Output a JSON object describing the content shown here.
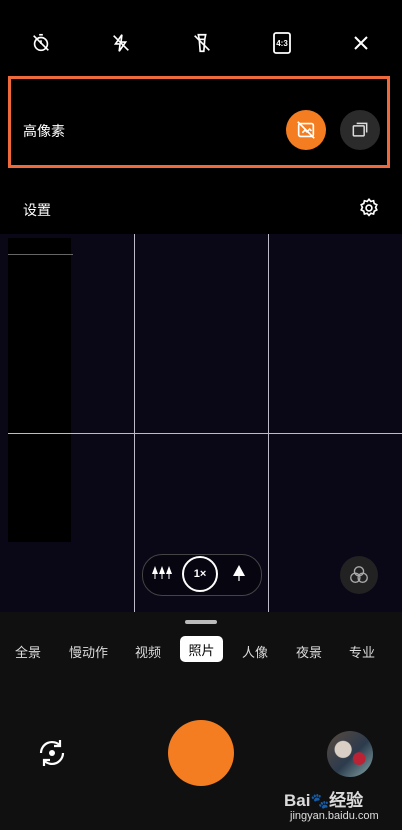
{
  "top_toolbar": {
    "icons": [
      "timer-off-icon",
      "flash-off-icon",
      "torch-off-icon",
      "aspect-ratio-icon",
      "close-icon"
    ],
    "aspect_ratio_label": "4:3"
  },
  "settings_panel": {
    "high_pixel_label": "高像素",
    "settings_label": "设置"
  },
  "viewfinder": {
    "zoom_label": "1×"
  },
  "modes": [
    {
      "label": "全景"
    },
    {
      "label": "慢动作"
    },
    {
      "label": "视频"
    },
    {
      "label": "照片",
      "active": true
    },
    {
      "label": "人像"
    },
    {
      "label": "夜景"
    },
    {
      "label": "专业"
    }
  ],
  "watermark": {
    "brand": "Bai",
    "brand_suffix": "经验",
    "url": "jingyan.baidu.com"
  },
  "colors": {
    "accent": "#f37d20",
    "highlight_border": "#ee6a3c"
  }
}
